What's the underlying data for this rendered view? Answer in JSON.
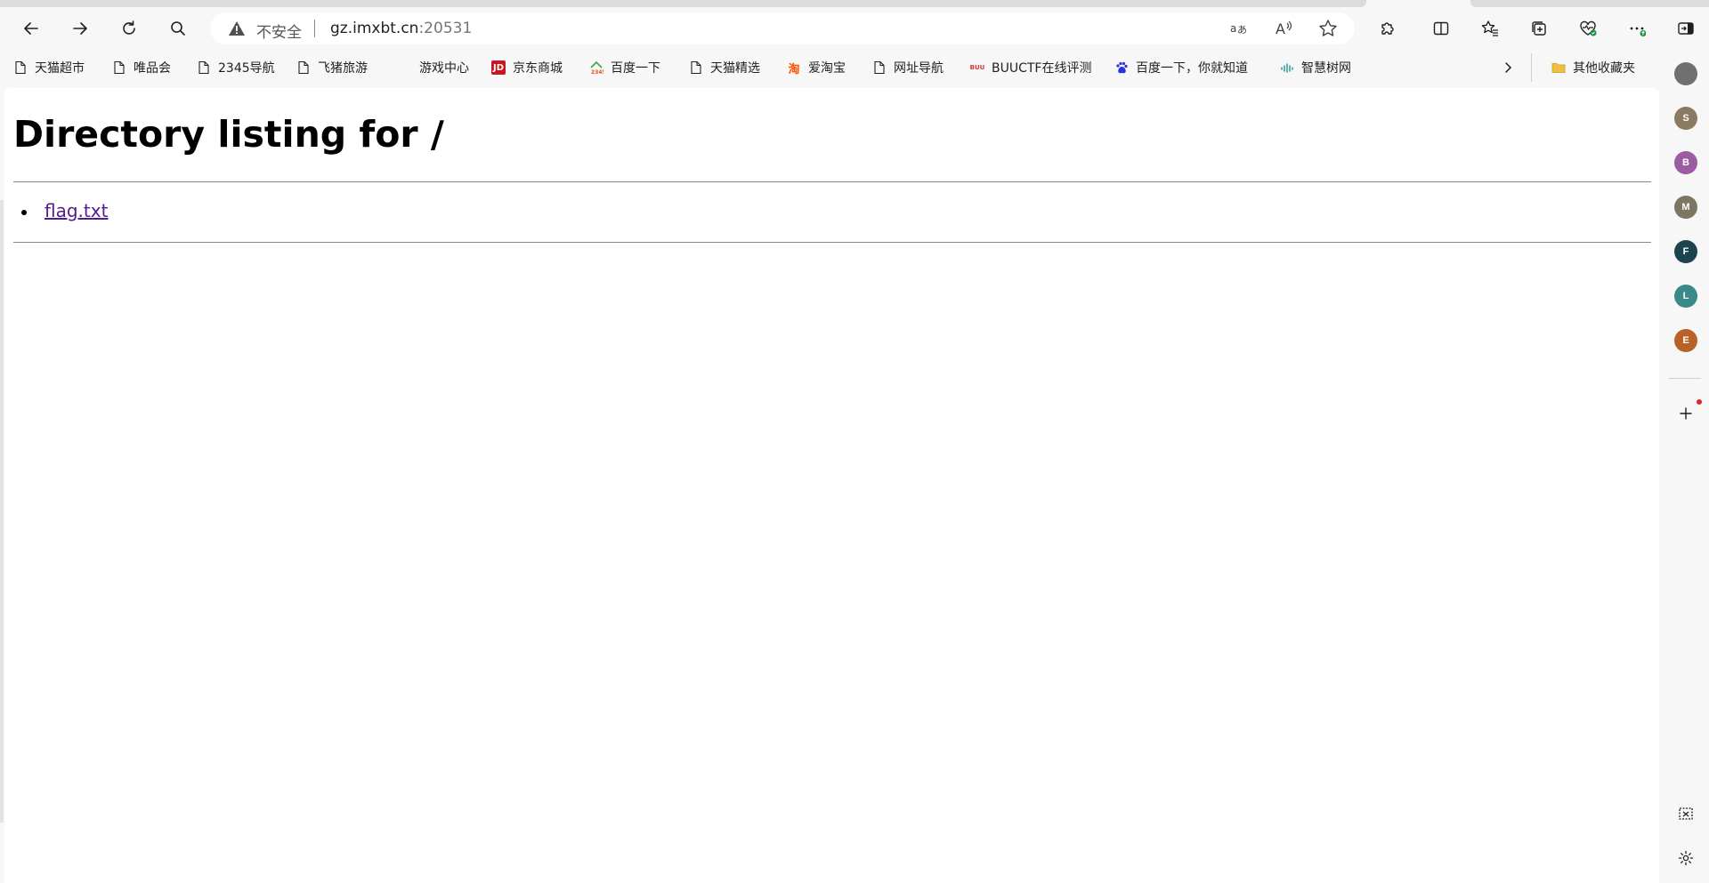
{
  "browser": {
    "address_bar": {
      "security_label": "不安全",
      "url_host": "gz.imxbt.cn",
      "url_port": ":20531"
    }
  },
  "bookmarks": [
    {
      "label": "天猫超市",
      "icon": "page-icon"
    },
    {
      "label": "唯品会",
      "icon": "page-icon"
    },
    {
      "label": "2345导航",
      "icon": "page-icon"
    },
    {
      "label": "飞猪旅游",
      "icon": "page-icon"
    },
    {
      "label": "游戏中心",
      "icon": "blank-icon"
    },
    {
      "label": "京东商城",
      "icon": "jd-icon",
      "color": "#c81623"
    },
    {
      "label": "百度一下",
      "icon": "2345-house-icon"
    },
    {
      "label": "天猫精选",
      "icon": "page-icon"
    },
    {
      "label": "爱淘宝",
      "icon": "taobao-icon",
      "color": "#ff5000"
    },
    {
      "label": "网址导航",
      "icon": "page-icon"
    },
    {
      "label": "BUUCTF在线评测",
      "icon": "buuctf-icon"
    },
    {
      "label": "百度一下，你就知道",
      "icon": "baidu-paw-icon",
      "color": "#2932e1"
    },
    {
      "label": "智慧树网",
      "icon": "zhihuishu-icon"
    },
    {
      "label": "其他收藏夹",
      "icon": "folder-icon",
      "color": "#f0c040"
    }
  ],
  "page": {
    "heading": "Directory listing for /",
    "entries": [
      {
        "name": "flag.txt"
      }
    ]
  },
  "sidebar": {
    "profiles": [
      {
        "letter": "",
        "color": "#707070"
      },
      {
        "letter": "S",
        "color": "#8a7a62"
      },
      {
        "letter": "B",
        "color": "#9b5ca0"
      },
      {
        "letter": "M",
        "color": "#7d7663"
      },
      {
        "letter": "F",
        "color": "#1c4450"
      },
      {
        "letter": "L",
        "color": "#3a8a8a"
      },
      {
        "letter": "E",
        "color": "#b8622a"
      }
    ]
  }
}
